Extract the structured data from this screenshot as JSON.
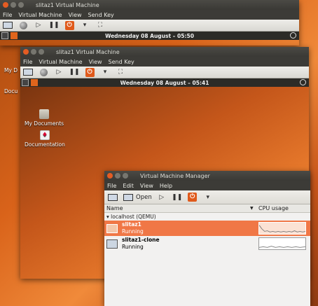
{
  "win1": {
    "title": "slitaz1 Virtual Machine",
    "menu": [
      "File",
      "Virtual Machine",
      "View",
      "Send Key"
    ],
    "clock": "Wednesday 08 August – 05:50"
  },
  "win2": {
    "title": "slitaz1 Virtual Machine",
    "menu": [
      "File",
      "Virtual Machine",
      "View",
      "Send Key"
    ],
    "clock": "Wednesday 08 August – 05:41",
    "desktop": {
      "icons": [
        {
          "label": "My Documents",
          "icon": "folder-icon"
        },
        {
          "label": "Documentation",
          "icon": "document-icon"
        }
      ],
      "side_labels": [
        "My D",
        "Docu"
      ]
    }
  },
  "vmm": {
    "title": "Virtual Machine Manager",
    "menu": [
      "File",
      "Edit",
      "View",
      "Help"
    ],
    "open_label": "Open",
    "columns": {
      "name": "Name",
      "cpu": "CPU usage"
    },
    "host": "localhost (QEMU)",
    "vms": [
      {
        "name": "slitaz1",
        "status": "Running",
        "selected": true
      },
      {
        "name": "slitaz1-clone",
        "status": "Running",
        "selected": false
      }
    ]
  },
  "colors": {
    "accent": "#e45c23",
    "selection": "#f07746",
    "panel": "#2c2b27"
  }
}
